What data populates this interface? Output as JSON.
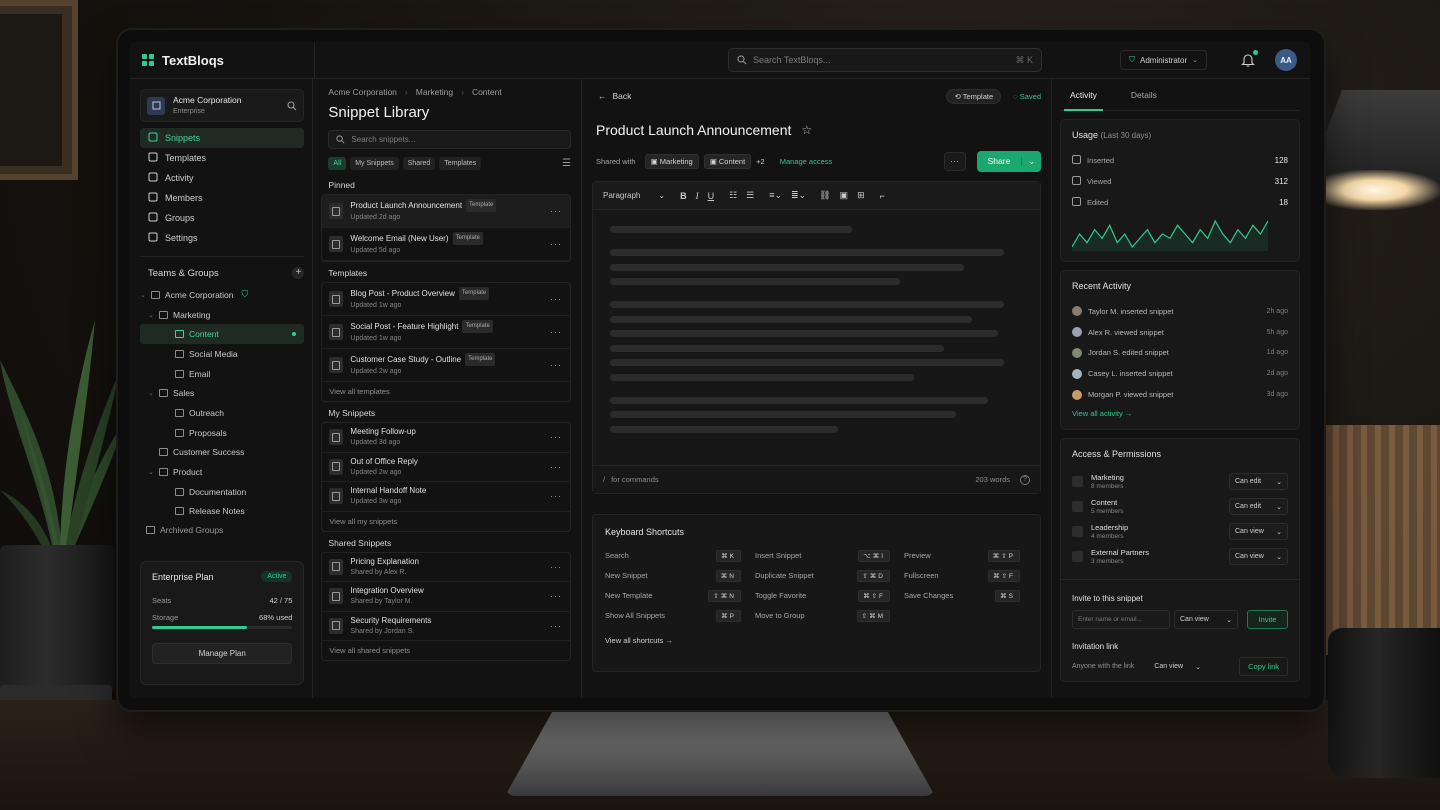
{
  "app": {
    "name": "TextBloqs"
  },
  "topbar": {
    "search_placeholder": "Search TextBloqs...",
    "search_shortcut": "⌘ K",
    "role": "Administrator",
    "avatar": "AA"
  },
  "org": {
    "name": "Acme Corporation",
    "plan": "Enterprise"
  },
  "nav": [
    {
      "label": "Snippets",
      "icon": "snippets-icon",
      "active": true
    },
    {
      "label": "Templates",
      "icon": "templates-icon"
    },
    {
      "label": "Activity",
      "icon": "activity-icon"
    },
    {
      "label": "Members",
      "icon": "members-icon"
    },
    {
      "label": "Groups",
      "icon": "groups-icon"
    },
    {
      "label": "Settings",
      "icon": "gear-icon"
    }
  ],
  "teams": {
    "title": "Teams & Groups",
    "tree": [
      {
        "label": "Acme Corporation",
        "level": 0
      },
      {
        "label": "Marketing",
        "level": 1
      },
      {
        "label": "Content",
        "level": 2,
        "active": true
      },
      {
        "label": "Social Media",
        "level": 2
      },
      {
        "label": "Email",
        "level": 2
      },
      {
        "label": "Sales",
        "level": 1
      },
      {
        "label": "Outreach",
        "level": 2
      },
      {
        "label": "Proposals",
        "level": 2
      },
      {
        "label": "Customer Success",
        "level": 1
      },
      {
        "label": "Product",
        "level": 1
      },
      {
        "label": "Documentation",
        "level": 2
      },
      {
        "label": "Release Notes",
        "level": 2
      }
    ],
    "archived": "Archived Groups"
  },
  "plan": {
    "title": "Enterprise Plan",
    "badge": "Active",
    "seats_label": "Seats",
    "seats_value": "42 / 75",
    "storage_label": "Storage",
    "storage_value": "68% used",
    "storage_fraction": 0.68,
    "button": "Manage Plan"
  },
  "library": {
    "breadcrumb": [
      "Acme Corporation",
      "Marketing",
      "Content"
    ],
    "title": "Snippet Library",
    "search_placeholder": "Search snippets...",
    "filters": [
      "All",
      "My Snippets",
      "Shared",
      "Templates"
    ],
    "groups": [
      {
        "title": "Pinned",
        "items": [
          {
            "name": "Product Launch Announcement",
            "tag": "Template",
            "meta": "Updated 2d ago",
            "selected": true
          },
          {
            "name": "Welcome Email (New User)",
            "tag": "Template",
            "meta": "Updated 5d ago"
          }
        ]
      },
      {
        "title": "Templates",
        "items": [
          {
            "name": "Blog Post - Product Overview",
            "tag": "Template",
            "meta": "Updated 1w ago"
          },
          {
            "name": "Social Post - Feature Highlight",
            "tag": "Template",
            "meta": "Updated 1w ago"
          },
          {
            "name": "Customer Case Study - Outline",
            "tag": "Template",
            "meta": "Updated 2w ago"
          }
        ],
        "view_all": "View all templates"
      },
      {
        "title": "My Snippets",
        "items": [
          {
            "name": "Meeting Follow-up",
            "meta": "Updated 3d ago"
          },
          {
            "name": "Out of Office Reply",
            "meta": "Updated 2w ago"
          },
          {
            "name": "Internal Handoff Note",
            "meta": "Updated 3w ago"
          }
        ],
        "view_all": "View all my snippets"
      },
      {
        "title": "Shared Snippets",
        "items": [
          {
            "name": "Pricing Explanation",
            "meta": "Shared by Alex R."
          },
          {
            "name": "Integration Overview",
            "meta": "Shared by Taylor M."
          },
          {
            "name": "Security Requirements",
            "meta": "Shared by Jordan S."
          }
        ],
        "view_all": "View all shared snippets"
      }
    ]
  },
  "editor": {
    "back": "Back",
    "template_badge": "Template",
    "saved": "Saved",
    "title": "Product Launch Announcement",
    "shared_with_label": "Shared with",
    "shared_with": [
      "Marketing",
      "Content"
    ],
    "shared_more": "+2",
    "manage_access": "Manage access",
    "more": "···",
    "share": "Share",
    "paragraph": "Paragraph",
    "footer_hint": "for commands",
    "word_count": "203 words"
  },
  "shortcuts": {
    "title": "Keyboard Shortcuts",
    "items": [
      {
        "label": "Search",
        "keys": "⌘K"
      },
      {
        "label": "Insert Snippet",
        "keys": "⌥⌘I"
      },
      {
        "label": "Preview",
        "keys": "⌘⇧P"
      },
      {
        "label": "New Snippet",
        "keys": "⌘N"
      },
      {
        "label": "Duplicate Snippet",
        "keys": "⇧⌘D"
      },
      {
        "label": "Fullscreen",
        "keys": "⌘⇧F"
      },
      {
        "label": "New Template",
        "keys": "⇧⌘N"
      },
      {
        "label": "Toggle Favorite",
        "keys": "⌘⇧F"
      },
      {
        "label": "Save Changes",
        "keys": "⌘S"
      },
      {
        "label": "Show All Snippets",
        "keys": "⌘P"
      },
      {
        "label": "Move to Group",
        "keys": "⇧⌘M"
      }
    ],
    "view_all": "View all shortcuts"
  },
  "panel": {
    "tabs": [
      "Activity",
      "Details"
    ],
    "usage": {
      "title": "Usage",
      "period": "(Last 30 days)",
      "stats": [
        {
          "label": "Inserted",
          "value": "128",
          "icon": "insert-icon"
        },
        {
          "label": "Viewed",
          "value": "312",
          "icon": "eye-icon"
        },
        {
          "label": "Edited",
          "value": "18",
          "icon": "edit-icon"
        }
      ],
      "spark": [
        6,
        9,
        7,
        10,
        8,
        11,
        7,
        9,
        6,
        8,
        10,
        7,
        9,
        8,
        11,
        9,
        7,
        10,
        8,
        12,
        9,
        7,
        10,
        8,
        11,
        9,
        12
      ]
    },
    "recent": {
      "title": "Recent Activity",
      "items": [
        {
          "text": "Taylor M. inserted snippet",
          "time": "2h ago",
          "color": "#8a7c6e"
        },
        {
          "text": "Alex R. viewed snippet",
          "time": "5h ago",
          "color": "#9aa3ad"
        },
        {
          "text": "Jordan S. edited snippet",
          "time": "1d ago",
          "color": "#7f8a70"
        },
        {
          "text": "Casey L. inserted snippet",
          "time": "2d ago",
          "color": "#a7b3bd"
        },
        {
          "text": "Morgan P. viewed snippet",
          "time": "3d ago",
          "color": "#c99a6a"
        }
      ],
      "view_all": "View all activity"
    },
    "access": {
      "title": "Access & Permissions",
      "items": [
        {
          "name": "Marketing",
          "members": "8 members",
          "perm": "Can edit"
        },
        {
          "name": "Content",
          "members": "5 members",
          "perm": "Can edit"
        },
        {
          "name": "Leadership",
          "members": "4 members",
          "perm": "Can view"
        },
        {
          "name": "External Partners",
          "members": "3 members",
          "perm": "Can view"
        }
      ],
      "invite_title": "Invite to this snippet",
      "invite_placeholder": "Enter name or email...",
      "invite_perm": "Can view",
      "invite_btn": "Invite",
      "link_title": "Invitation link",
      "link_scope": "Anyone with the link",
      "link_perm": "Can view",
      "copy": "Copy link"
    }
  },
  "colors": {
    "accent": "#2ecc8f",
    "bg": "#121212"
  }
}
